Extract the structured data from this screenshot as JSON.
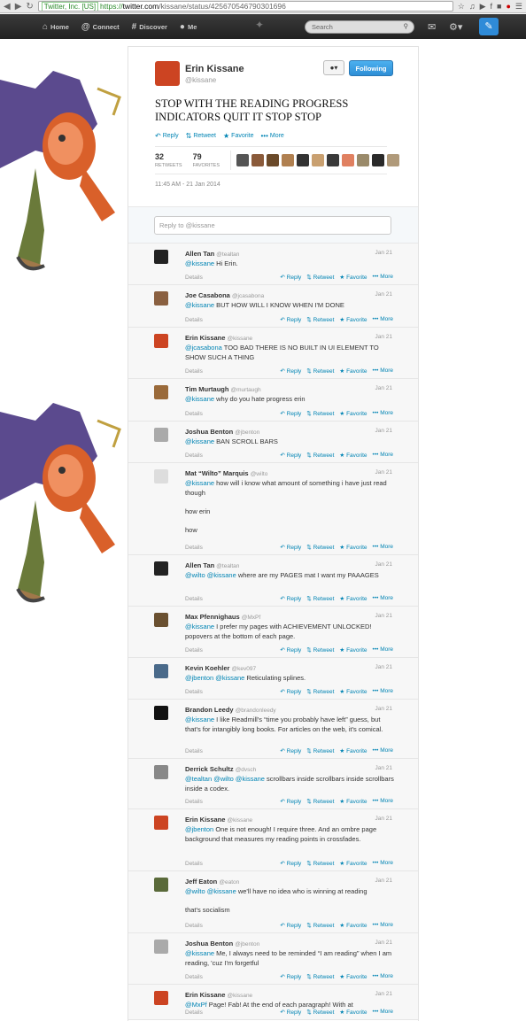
{
  "browser": {
    "ev_label": "Twitter, Inc. [US]",
    "url_scheme": "https://",
    "url_host": "twitter.com",
    "url_path": "/kissane/status/425670546790301696"
  },
  "topbar": {
    "home": "Home",
    "connect": "Connect",
    "discover": "Discover",
    "me": "Me",
    "search_placeholder": "Search"
  },
  "tweet": {
    "name": "Erin Kissane",
    "handle": "@kissane",
    "follow_label": "Following",
    "text": "STOP WITH THE READING PROGRESS INDICATORS QUIT IT STOP STOP",
    "actions": {
      "reply": "Reply",
      "retweet": "Retweet",
      "favorite": "Favorite",
      "more": "More"
    },
    "retweets": "32",
    "retweets_label": "RETWEETS",
    "favorites": "79",
    "favorites_label": "FAVORITES",
    "timestamp": "11:45 AM - 21 Jan 2014",
    "fave_avatar_colors": [
      "#555",
      "#8a5a3a",
      "#6b4a2a",
      "#b08050",
      "#333",
      "#c9a070",
      "#3a3a3a",
      "#e08060",
      "#9a8a6a",
      "#2a2a2a",
      "#b09a7a"
    ]
  },
  "reply_box": {
    "placeholder": "Reply to @kissane"
  },
  "reply_actions": {
    "details": "Details",
    "reply": "Reply",
    "retweet": "Retweet",
    "favorite": "Favorite",
    "more": "More"
  },
  "replies": [
    {
      "name": "Allen Tan",
      "handle": "@tealtan",
      "time": "Jan 21",
      "mentions": "@kissane",
      "text": " Hi Erin.",
      "av": "#222"
    },
    {
      "name": "Joe Casabona",
      "handle": "@jcasabona",
      "time": "Jan 21",
      "mentions": "@kissane",
      "text": " BUT HOW WILL I KNOW WHEN I'M DONE",
      "av": "#8a6040"
    },
    {
      "name": "Erin Kissane",
      "handle": "@kissane",
      "time": "Jan 21",
      "mentions": "@jcasabona",
      "text": " TOO BAD THERE IS NO BUILT IN UI ELEMENT TO SHOW SUCH A THING",
      "av": "#c42"
    },
    {
      "name": "Tim Murtaugh",
      "handle": "@murtaugh",
      "time": "Jan 21",
      "mentions": "@kissane",
      "text": " why do you hate progress erin",
      "av": "#9a6a3a"
    },
    {
      "name": "Joshua Benton",
      "handle": "@jbenton",
      "time": "Jan 21",
      "mentions": "@kissane",
      "text": " BAN SCROLL BARS",
      "av": "#aaa"
    },
    {
      "name": "Mat “Wilto” Marquis",
      "handle": "@wilto",
      "time": "Jan 21",
      "mentions": "@kissane",
      "text": " how will i know what amount of something i have just read though\n\nhow erin\n\nhow",
      "av": "#ddd"
    },
    {
      "name": "Allen Tan",
      "handle": "@tealtan",
      "time": "Jan 21",
      "mentions": "@wilto @kissane",
      "text": " where are my PAGES mat I want my PAAAGES",
      "av": "#222"
    },
    {
      "name": "Max Pfennighaus",
      "handle": "@MxPf",
      "time": "Jan 21",
      "mentions": "@kissane",
      "text": " I prefer my pages with ACHIEVEMENT UNLOCKED! popovers at the bottom of each page.",
      "av": "#6a5030"
    },
    {
      "name": "Kevin Koehler",
      "handle": "@kev097",
      "time": "Jan 21",
      "mentions": "@jbenton @kissane",
      "text": " Reticulating splines.",
      "av": "#4a6a8a"
    },
    {
      "name": "Brandon Leedy",
      "handle": "@brandonleedy",
      "time": "Jan 21",
      "mentions": "@kissane",
      "text": " I like Readmill's “time you probably have left” guess, but that's for intangibly long books. For articles on the web, it's comical.",
      "av": "#111"
    },
    {
      "name": "Derrick Schultz",
      "handle": "@dvsch",
      "time": "Jan 21",
      "mentions": "@tealtan @wilto @kissane",
      "text": " scrollbars inside scrollbars inside scrollbars inside a codex.",
      "av": "#888"
    },
    {
      "name": "Erin Kissane",
      "handle": "@kissane",
      "time": "Jan 21",
      "mentions": "@jbenton",
      "text": " One is not enough! I require three. And an ombre page background that measures my reading points in crossfades.",
      "av": "#c42"
    },
    {
      "name": "Jeff Eaton",
      "handle": "@eaton",
      "time": "Jan 21",
      "mentions": "@wilto @kissane",
      "text": " we'll have no idea who is winning at reading\n\nthat's socialism",
      "av": "#5a6a3a"
    },
    {
      "name": "Joshua Benton",
      "handle": "@jbenton",
      "time": "Jan 21",
      "mentions": "@kissane",
      "text": " Me, I always need to be reminded “I am reading” when I am reading, 'cuz I'm forgetful",
      "av": "#aaa"
    },
    {
      "name": "Erin Kissane",
      "handle": "@kissane",
      "time": "Jan 21",
      "mentions": "@MxPf",
      "text": " Page! Fab! At the end of each paragraph! With at",
      "av": "#c42"
    }
  ]
}
